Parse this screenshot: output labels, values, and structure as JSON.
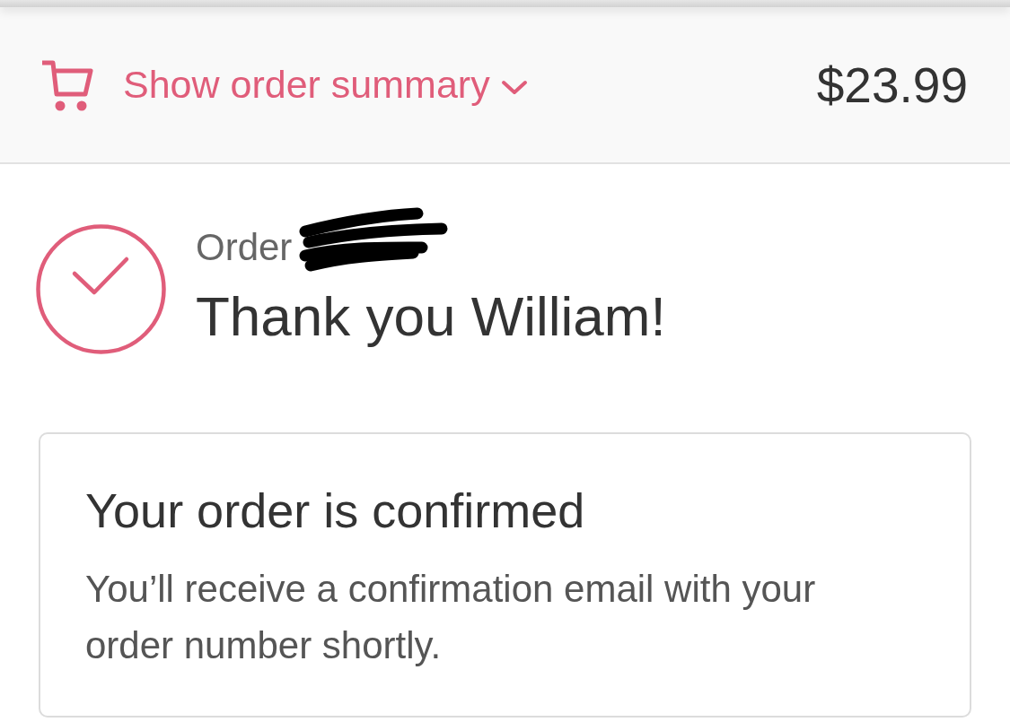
{
  "header": {
    "summary_toggle": {
      "label": "Show order summary",
      "expanded": false
    },
    "total": "$23.99"
  },
  "confirmation": {
    "order_label": "Order",
    "order_number_redacted": true,
    "greeting": "Thank you William!"
  },
  "card": {
    "title": "Your order is confirmed",
    "message": "You’ll receive a confirmation email with your order number shortly."
  }
}
